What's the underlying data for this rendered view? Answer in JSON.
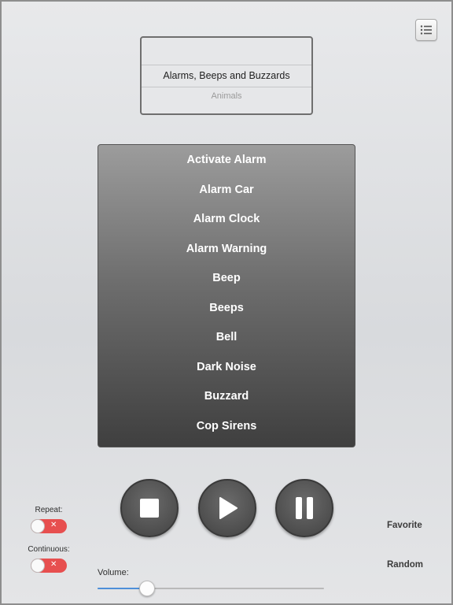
{
  "header": {
    "menu_icon": "list-icon"
  },
  "category_picker": {
    "selected": "Alarms, Beeps and Buzzards",
    "next": "Animals"
  },
  "sound_list": {
    "items": [
      "Activate Alarm",
      "Alarm Car",
      "Alarm Clock",
      "Alarm Warning",
      "Beep",
      "Beeps",
      "Bell",
      "Dark Noise",
      "Buzzard",
      "Cop Sirens"
    ]
  },
  "controls": {
    "stop_icon": "stop-icon",
    "play_icon": "play-icon",
    "pause_icon": "pause-icon"
  },
  "repeat": {
    "label": "Repeat:",
    "state": "off"
  },
  "continuous": {
    "label": "Continuous:",
    "state": "off"
  },
  "favorite_label": "Favorite",
  "random_label": "Random",
  "volume": {
    "label": "Volume:",
    "value": 0.22
  },
  "colors": {
    "toggle_off": "#e74f4f",
    "slider_fill": "#4d8fd9"
  }
}
